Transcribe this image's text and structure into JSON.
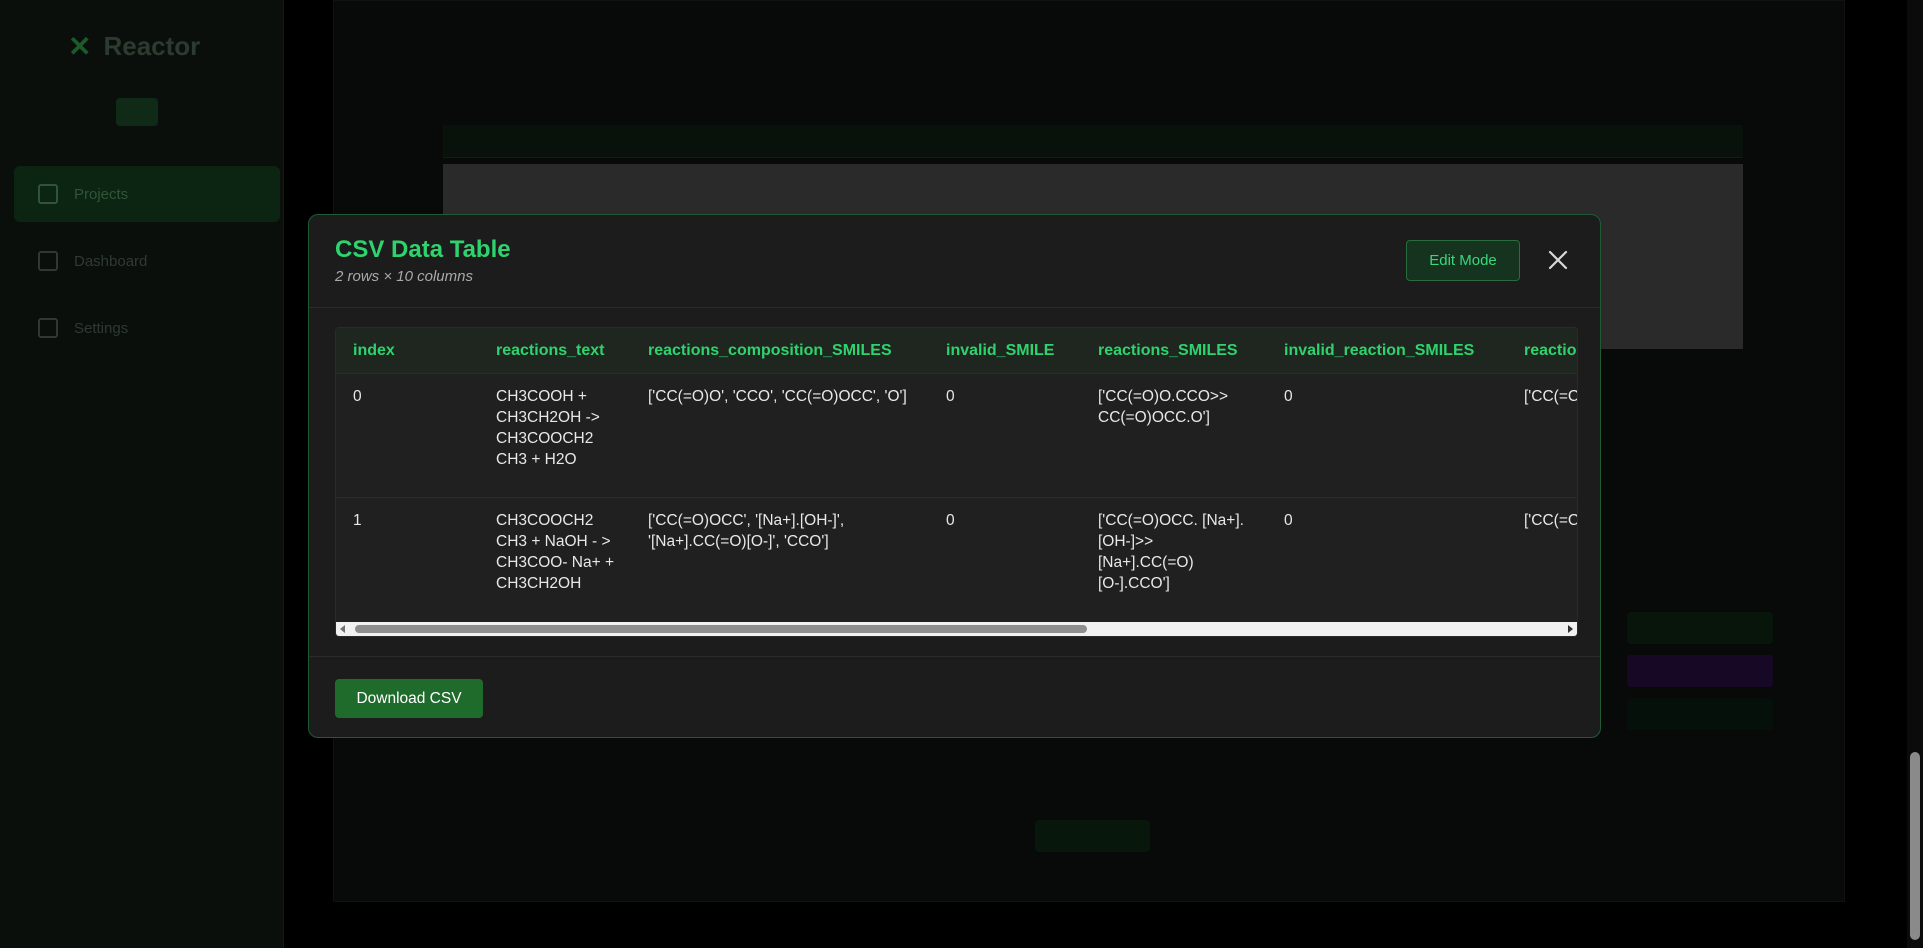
{
  "background": {
    "app_name": "Reactor",
    "nav_items": [
      "Projects",
      "Dashboard",
      "Settings"
    ]
  },
  "modal": {
    "title": "CSV Data Table",
    "subtitle": "2 rows × 10 columns",
    "edit_button": "Edit Mode",
    "close_icon": "close-icon",
    "download_button": "Download CSV",
    "columns": [
      "index",
      "reactions_text",
      "reactions_composition_SMILES",
      "invalid_SMILE",
      "reactions_SMILES",
      "invalid_reaction_SMILES",
      "reactio"
    ],
    "rows": [
      [
        "0",
        "CH3COOH + CH3CH2OH -> CH3COOCH2 CH3 + H2O",
        "['CC(=O)O', 'CCO', 'CC(=O)OCC', 'O']",
        "0",
        "['CC(=O)O.CCO>> CC(=O)OCC.O']",
        "0",
        "['CC(=C COC(=("
      ],
      [
        "1",
        "CH3COOCH2 CH3 + NaOH - > CH3COO- Na+ + CH3CH2OH",
        "['CC(=O)OCC', '[Na+].[OH-]', '[Na+].CC(=O)[O-]', 'CCO']",
        "0",
        "['CC(=O)OCC. [Na+].[OH-]>> [Na+].CC(=O) [O-].CCO']",
        "0",
        "['CC(=C [OH-]>> [O-]C(="
      ]
    ]
  }
}
